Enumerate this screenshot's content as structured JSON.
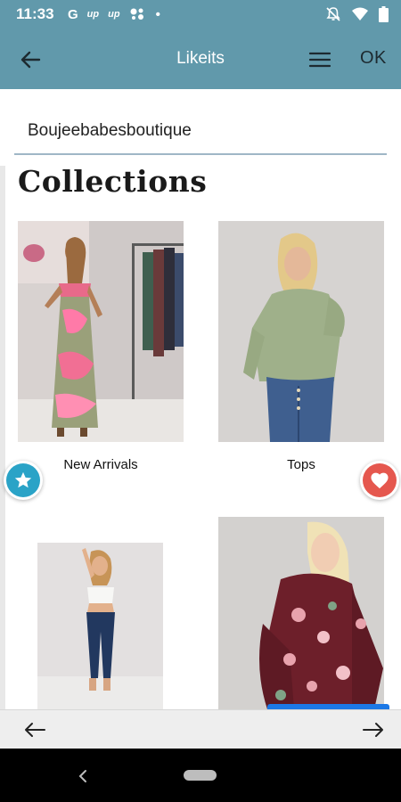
{
  "status_bar": {
    "time": "11:33",
    "notification_icons": [
      "G",
      "up",
      "up",
      "assistant-icon",
      "•"
    ],
    "right_icons": [
      "dnd-off-icon",
      "wifi-icon",
      "battery-icon"
    ]
  },
  "toolbar": {
    "title": "Likeits",
    "ok_label": "OK",
    "back_icon": "arrow-left-icon",
    "menu_icon": "hamburger-menu-icon"
  },
  "store": {
    "name": "Boujeebabesboutique"
  },
  "collections": {
    "heading": "Collections",
    "items": [
      {
        "label": "New Arrivals",
        "image": "tie-dye-maxi-dress-photo"
      },
      {
        "label": "Tops",
        "image": "green-sweater-photo"
      },
      {
        "label": "",
        "image": "white-crop-top-jeans-photo"
      },
      {
        "label": "",
        "image": "burgundy-floral-top-photo"
      }
    ]
  },
  "fabs": {
    "star_icon": "star-icon",
    "heart_icon": "heart-icon"
  },
  "colors": {
    "toolbar": "#6199ab",
    "star_fab": "#2aa3c7",
    "heart_fab": "#e5574e",
    "accent_blue": "#1c78e6"
  }
}
